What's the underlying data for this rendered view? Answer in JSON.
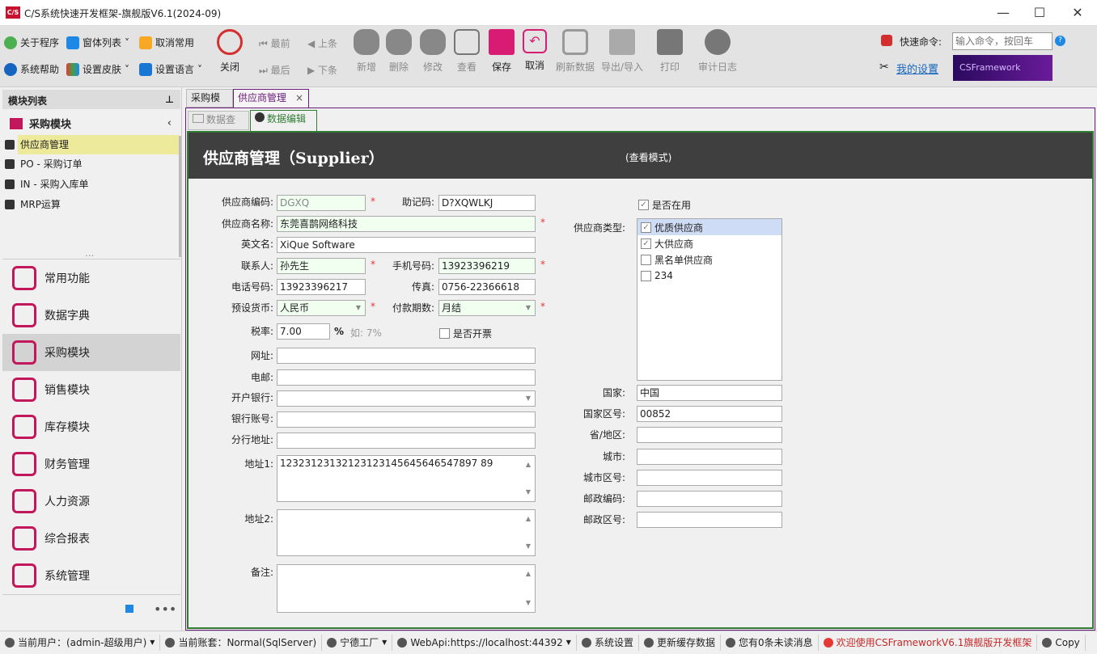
{
  "window": {
    "title": "C/S系统快速开发框架-旗舰版V6.1(2024-09)",
    "logo": "C/S"
  },
  "toolbar": {
    "small": [
      {
        "label": "关于程序",
        "icon": "about-icon"
      },
      {
        "label": "窗体列表",
        "icon": "windows-icon"
      },
      {
        "label": "取消常用",
        "icon": "clipboard-icon"
      },
      {
        "label": "系统帮助",
        "icon": "help-icon"
      },
      {
        "label": "设置皮肤",
        "icon": "skin-icon"
      },
      {
        "label": "设置语言",
        "icon": "language-icon"
      }
    ],
    "close": "关闭",
    "nav": {
      "first": "最前",
      "prev": "上条",
      "last": "最后",
      "next": "下条"
    },
    "buttons": [
      {
        "label": "新增",
        "enabled": false
      },
      {
        "label": "删除",
        "enabled": false
      },
      {
        "label": "修改",
        "enabled": false
      },
      {
        "label": "查看",
        "enabled": false
      },
      {
        "label": "保存",
        "enabled": true
      },
      {
        "label": "取消",
        "enabled": true
      },
      {
        "label": "刷新数据",
        "enabled": false
      },
      {
        "label": "导出/导入",
        "enabled": false
      },
      {
        "label": "打印",
        "enabled": false
      },
      {
        "label": "审计日志",
        "enabled": false
      }
    ],
    "quick_cmd_label": "快速命令:",
    "quick_cmd_placeholder": "输入命令，按回车",
    "my_settings": "我的设置",
    "banner": "CSFramework"
  },
  "sidebar": {
    "title": "模块列表",
    "group": "采购模块",
    "tree": [
      "供应商管理",
      "PO - 采购订单",
      "IN - 采购入库单",
      "MRP运算"
    ],
    "nav": [
      "常用功能",
      "数据字典",
      "采购模块",
      "销售模块",
      "库存模块",
      "财务管理",
      "人力资源",
      "综合报表",
      "系统管理"
    ],
    "more": "..."
  },
  "tabs": [
    "采购模块",
    "供应商管理"
  ],
  "subtabs": [
    "数据查询",
    "数据编辑"
  ],
  "form": {
    "title": "供应商管理（Supplier）",
    "mode": "(查看模式)",
    "labels": {
      "code": "供应商编码:",
      "mnemonic": "助记码:",
      "name": "供应商名称:",
      "en_name": "英文名:",
      "contact": "联系人:",
      "mobile": "手机号码:",
      "phone": "电话号码:",
      "fax": "传真:",
      "currency": "预设货币:",
      "payment": "付款期数:",
      "tax": "税率:",
      "website": "网址:",
      "email": "电邮:",
      "bank": "开户银行:",
      "account": "银行账号:",
      "branch": "分行地址:",
      "addr1": "地址1:",
      "addr2": "地址2:",
      "remark": "备注:",
      "type": "供应商类型:",
      "country": "国家:",
      "country_code": "国家区号:",
      "province": "省/地区:",
      "city": "城市:",
      "city_code": "城市区号:",
      "postcode": "邮政编码:",
      "postal_zone": "邮政区号:"
    },
    "values": {
      "code": "DGXQ",
      "mnemonic": "D?XQWLKJ",
      "name": "东莞喜鹊网络科技",
      "en_name": "XiQue Software",
      "contact": "孙先生",
      "mobile": "13923396219",
      "phone": "13923396217",
      "fax": "0756-22366618",
      "currency": "人民币",
      "payment": "月结",
      "tax": "7.00",
      "website": "",
      "email": "",
      "bank": "",
      "account": "",
      "branch": "",
      "addr1": "12323123132123123145645646547897 89",
      "addr2": "",
      "remark": "",
      "country": "中国",
      "country_code": "00852",
      "province": "",
      "city": "",
      "city_code": "",
      "postcode": "",
      "postal_zone": ""
    },
    "tax_unit": "%",
    "tax_hint": "如: 7%",
    "invoice": {
      "label": "是否开票",
      "checked": false
    },
    "active": {
      "label": "是否在用",
      "checked": true
    },
    "types": [
      {
        "label": "优质供应商",
        "checked": true
      },
      {
        "label": "大供应商",
        "checked": true
      },
      {
        "label": "黑名单供应商",
        "checked": false
      },
      {
        "label": "234",
        "checked": false
      }
    ],
    "required_mark": "*"
  },
  "statusbar": [
    "当前用户：(admin-超级用户)",
    "当前账套：Normal(SqlServer)",
    "宁德工厂",
    "WebApi:https://localhost:44392",
    "系统设置",
    "更新缓存数据",
    "您有0条未读消息",
    "欢迎使用CSFrameworkV6.1旗舰版开发框架",
    "Copy"
  ],
  "colors": {
    "accent": "#c2185b",
    "save": "#d81b73",
    "header": "#3f3f3f",
    "required_bg": "#f0fff0",
    "selected_tree": "#eeea9c",
    "status_warn": "#c62828"
  }
}
